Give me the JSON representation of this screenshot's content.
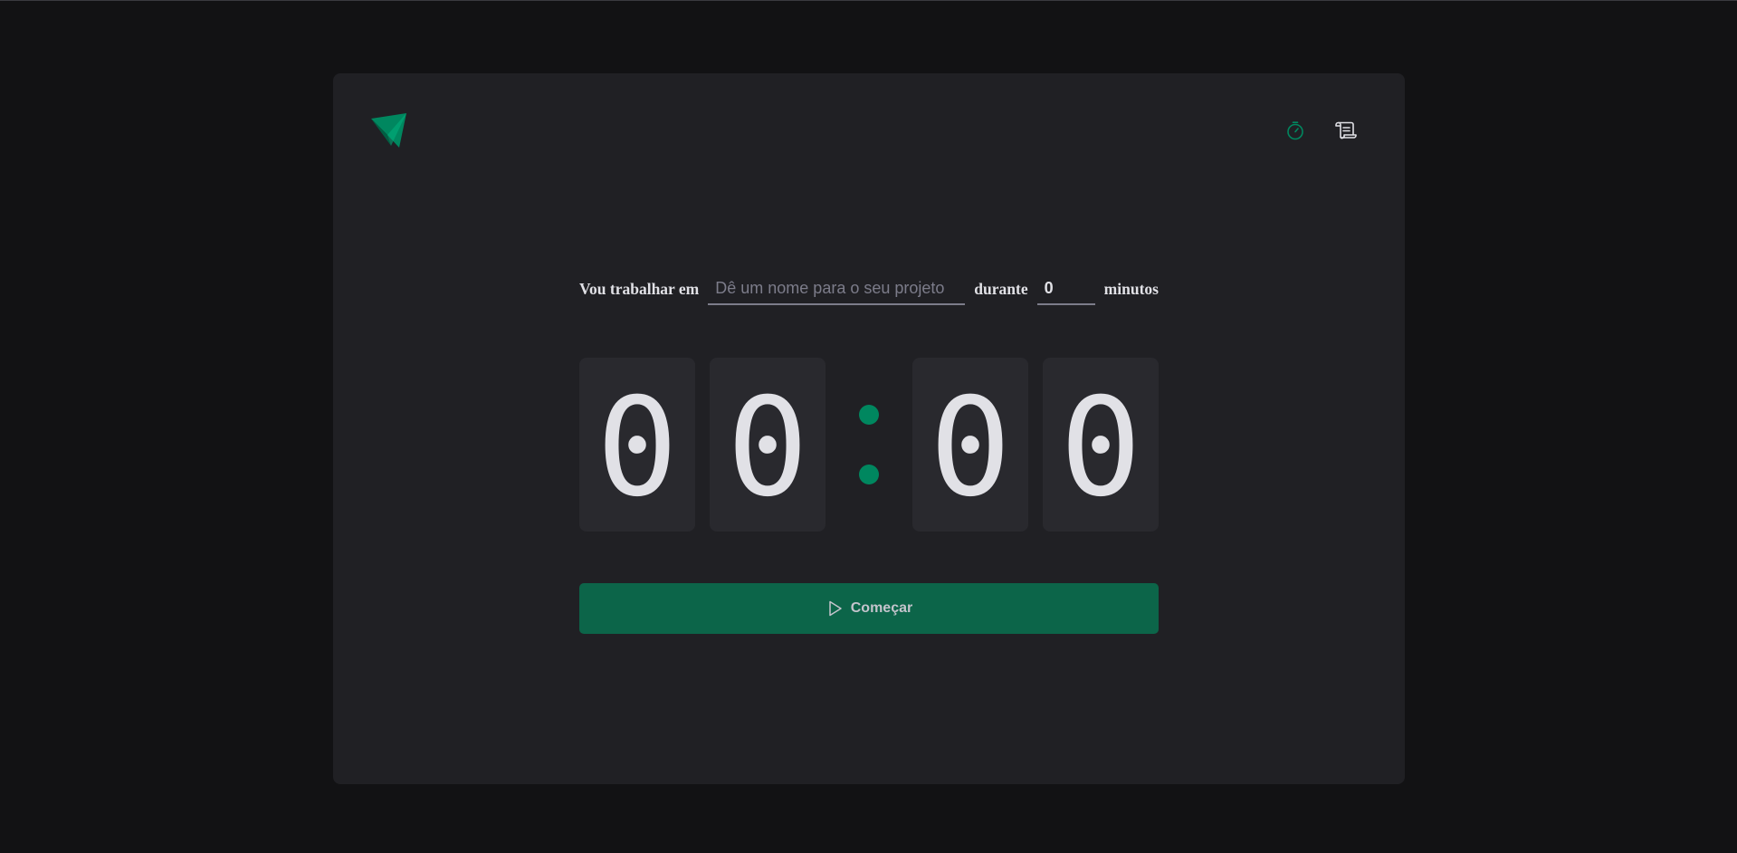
{
  "header": {
    "logo_icon": "paper-plane-logo-icon",
    "nav": [
      {
        "name": "timer",
        "icon": "timer-icon",
        "active": true
      },
      {
        "name": "history",
        "icon": "scroll-icon",
        "active": false
      }
    ]
  },
  "form": {
    "label_work": "Vou trabalhar em",
    "project_placeholder": "Dê um nome para o seu projeto",
    "project_value": "",
    "label_during": "durante",
    "minutes_value": "0",
    "label_minutes": "minutos"
  },
  "countdown": {
    "minutes_tens": "0",
    "minutes_units": "0",
    "seconds_tens": "0",
    "seconds_units": "0"
  },
  "start_button": {
    "label": "Começar",
    "icon": "play-icon"
  },
  "colors": {
    "background": "#121214",
    "card": "#202024",
    "digit_box": "#29292e",
    "accent": "#00875f",
    "button": "#0c6549",
    "text": "#e1e1e6",
    "placeholder": "#7c7c8a"
  }
}
